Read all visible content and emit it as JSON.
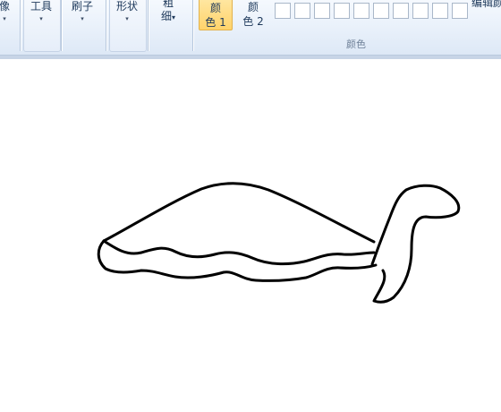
{
  "ribbon": {
    "image_label": "像",
    "tools_label": "工具",
    "brushes_label": "刷子",
    "shapes_label": "形状",
    "size_label_line1": "粗",
    "size_label_line2": "细",
    "color1_line1": "颜",
    "color1_line2": "色 1",
    "color2_line1": "颜",
    "color2_line2": "色 2",
    "colors_group_label": "颜色",
    "edit_colors_label": "编辑颜",
    "dropdown_glyph": "▾",
    "palette_swatches": [
      "#ffffff",
      "#ffffff",
      "#ffffff",
      "#ffffff",
      "#ffffff",
      "#ffffff",
      "#ffffff",
      "#ffffff",
      "#ffffff",
      "#ffffff"
    ]
  },
  "canvas": {
    "stroke_color": "#000000",
    "background": "#ffffff"
  }
}
